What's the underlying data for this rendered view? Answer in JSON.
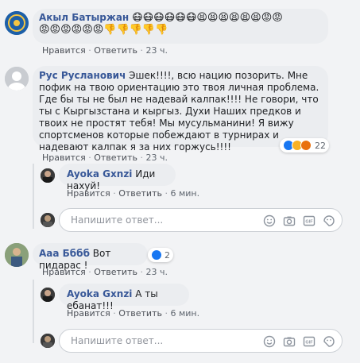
{
  "comments": {
    "c1": {
      "author": "Акыл Батыржан",
      "emojis_line1": "😷😷😷😷😷😷😫😫😫😫😫😫😡😡",
      "emojis_line2": "😡😡😡😡😡😡👎👎👎👎👎",
      "like": "Нравится",
      "reply": "Ответить",
      "time": "23 ч."
    },
    "c2": {
      "author": "Рус Русланович",
      "text": "Эшек!!!!, всю нацию позорить. Мне пофик на твою ориентацию это твоя личная проблема. Где бы ты не был не надевай калпак!!!! Не говори, что ты с Кыргызстана и кыргыз. Духи Наших предков и твоих не простят тебя! Мы мусульманини! Я вижу спортсменов которые побеждают в турнирах и надевают калпак я за них горжусь!!!!",
      "like": "Нравится",
      "reply": "Ответить",
      "time": "23 ч.",
      "reaction_count": "22"
    },
    "r1": {
      "author": "Ayoka Gxnzi",
      "text": "Иди нахуй!",
      "like": "Нравится",
      "reply": "Ответить",
      "time": "6 мин."
    },
    "c3": {
      "author": "Ааа Бббб",
      "text": "Вот пидарас !",
      "like": "Нравится",
      "reply": "Ответить",
      "time": "23 ч.",
      "reaction_count": "2"
    },
    "r2": {
      "author": "Ayoka Gxnzi",
      "text": "А ты ебанат!!!",
      "like": "Нравится",
      "reply": "Ответить",
      "time": "6 мин."
    }
  },
  "reply_box": {
    "placeholder": "Напишите ответ..."
  },
  "icons": [
    "emoji-icon",
    "camera-icon",
    "gif-icon",
    "sticker-icon"
  ],
  "colors": {
    "name": "#385898",
    "bubble": "#ebedf0",
    "meta": "#606770",
    "like_blue": "#1877f2",
    "haha_yellow": "#f7b125",
    "angry_orange": "#e9710f"
  }
}
